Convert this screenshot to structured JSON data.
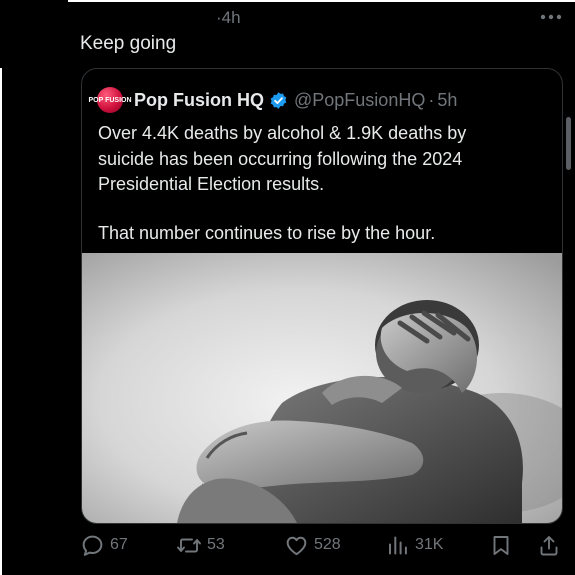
{
  "post": {
    "time_prefix": "·",
    "time": "4h",
    "text": "Keep going"
  },
  "quoted": {
    "avatar_text": "POP FUSION",
    "author_name": "Pop Fusion HQ",
    "verified_icon": "verified-badge-icon",
    "handle": "@PopFusionHQ",
    "separator": "·",
    "time": "5h",
    "paragraphs": [
      "Over 4.4K deaths by alcohol & 1.9K deaths by suicide has been occurring following the 2024 Presidential Election results.",
      "That number continues to rise by the hour."
    ],
    "media_description_icon": "photo-distressed-man-icon"
  },
  "actions": {
    "replies": "67",
    "reposts": "53",
    "likes": "528",
    "views": "31K"
  },
  "icons": {
    "more": "more-horizontal-icon",
    "reply": "reply-icon",
    "repost": "repost-icon",
    "like": "heart-icon",
    "views": "analytics-icon",
    "bookmark": "bookmark-icon",
    "share": "share-icon"
  },
  "colors": {
    "background": "#000000",
    "text": "#e7e9ea",
    "secondary": "#71767b",
    "border": "#2f3336",
    "verified": "#1d9bf0"
  }
}
